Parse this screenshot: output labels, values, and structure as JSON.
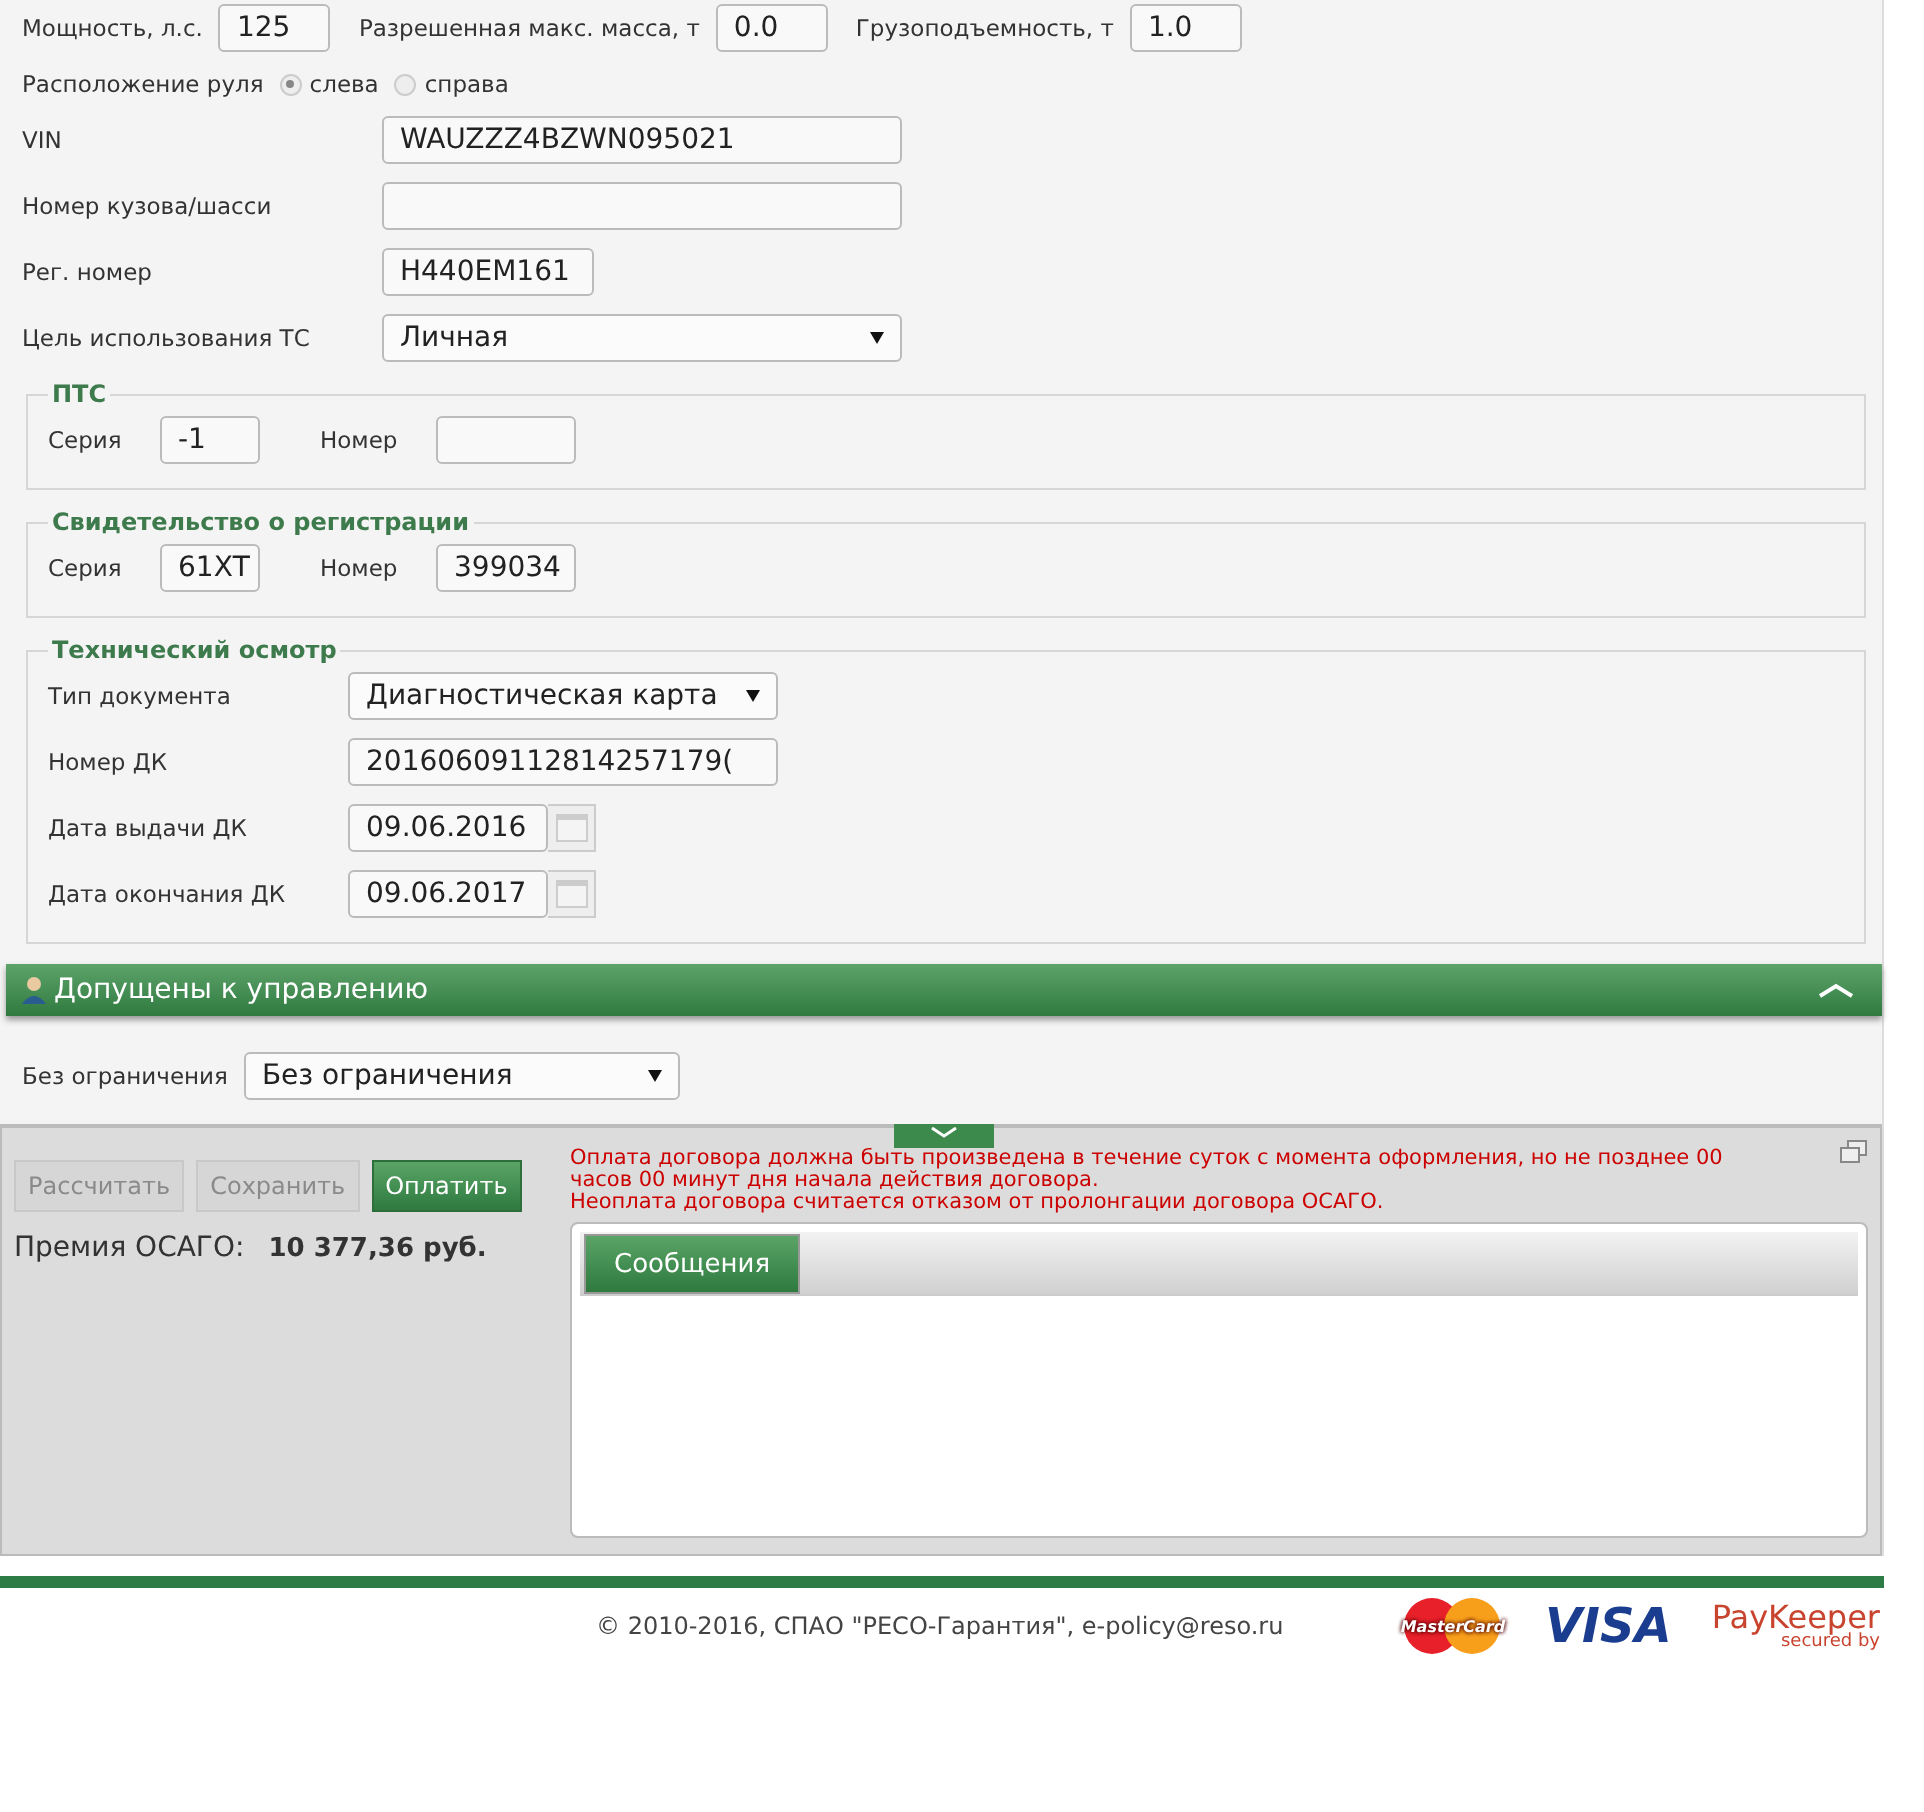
{
  "top_fields": [
    {
      "label": "Мощность, л.с.",
      "value": "125"
    },
    {
      "label": "Разрешенная макс. масса, т",
      "value": "0.0"
    },
    {
      "label": "Грузоподъемность, т",
      "value": "1.0"
    }
  ],
  "steering": {
    "label": "Расположение руля",
    "options": [
      {
        "label": "слева",
        "selected": true
      },
      {
        "label": "справа",
        "selected": false
      }
    ]
  },
  "fields": [
    {
      "kind": "input",
      "label": "VIN",
      "value": "WAUZZZ4BZWN095021"
    },
    {
      "kind": "input",
      "label": "Номер кузова/шасси"
    },
    {
      "kind": "input",
      "label": "Рег. номер",
      "value": "Н440ЕМ161"
    },
    {
      "kind": "select",
      "label": "Цель использования ТС",
      "value": "Личная"
    }
  ],
  "sections": [
    {
      "title": "ПТС",
      "rows": [
        {
          "kind": "pair",
          "label": "Серия",
          "value": "-1",
          "label2": "Номер"
        }
      ]
    },
    {
      "title": "Свидетельство о регистрации",
      "rows": [
        {
          "kind": "pair",
          "label": "Серия",
          "value": "61ХТ",
          "label2": "Номер",
          "value2": "399034"
        }
      ]
    },
    {
      "title": "Технический осмотр",
      "rows": [
        {
          "kind": "select",
          "label": "Тип документа",
          "value": "Диагностическая карта"
        },
        {
          "kind": "input",
          "label": "Номер ДК",
          "value": "20160609112814257179("
        },
        {
          "kind": "date",
          "label": "Дата выдачи ДК",
          "value": "09.06.2016"
        },
        {
          "kind": "date",
          "label": "Дата окончания ДК",
          "value": "09.06.2017"
        }
      ]
    }
  ],
  "drivers_panel": {
    "title": "Допущены к управлению",
    "expanded": true,
    "restriction": {
      "label": "Без ограничения",
      "value": "Без ограничения"
    }
  },
  "bottom_panel": {
    "buttons": [
      {
        "label": "Рассчитать",
        "disabled": true
      },
      {
        "label": "Сохранить",
        "disabled": true
      },
      {
        "label": "Оплатить",
        "disabled": false
      }
    ],
    "premium": {
      "label": "Премия ОСАГО:",
      "value": "10 377,36 руб."
    },
    "notice": [
      "Оплата договора должна быть произведена в течение суток с момента оформления, но не позднее 00 часов 00 минут дня начала действия договора.",
      "Неоплата договора считается отказом от пролонгации договора ОСАГО."
    ],
    "tabs": [
      {
        "label": "Сообщения",
        "selected": true
      }
    ]
  },
  "footer": {
    "copyright": "© 2010-2016, СПАО \"РЕСО-Гарантия\", e-policy@reso.ru",
    "logos": [
      {
        "kind": "mastercard",
        "text": "MasterCard"
      },
      {
        "kind": "visa",
        "text": "VISA"
      },
      {
        "kind": "paykeeper",
        "text": "PayKeeper",
        "sub": "secured by"
      }
    ]
  }
}
